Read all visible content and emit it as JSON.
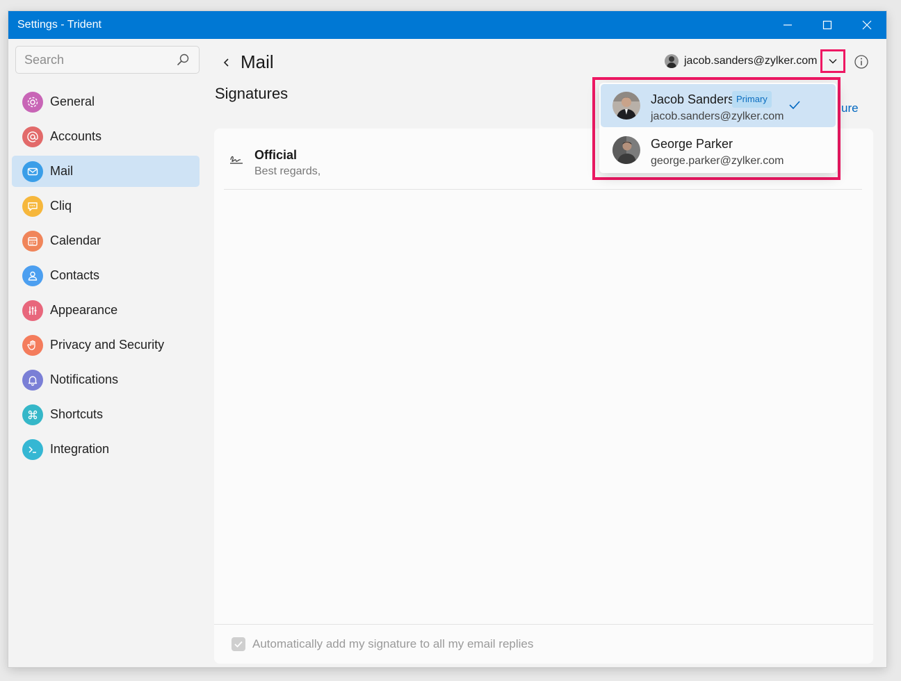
{
  "window": {
    "title": "Settings - Trident"
  },
  "sidebar": {
    "search_placeholder": "Search",
    "items": [
      {
        "label": "General",
        "icon": "gear-icon",
        "color": "#c865b6"
      },
      {
        "label": "Accounts",
        "icon": "at-icon",
        "color": "#e26a6a"
      },
      {
        "label": "Mail",
        "icon": "mail-icon",
        "color": "#3a9ee8",
        "active": true
      },
      {
        "label": "Cliq",
        "icon": "chat-icon",
        "color": "#f6b73c"
      },
      {
        "label": "Calendar",
        "icon": "calendar-icon",
        "color": "#f0855a"
      },
      {
        "label": "Contacts",
        "icon": "person-icon",
        "color": "#4c9ff0"
      },
      {
        "label": "Appearance",
        "icon": "sliders-icon",
        "color": "#e8677c"
      },
      {
        "label": "Privacy and Security",
        "icon": "hand-icon",
        "color": "#f47c5c"
      },
      {
        "label": "Notifications",
        "icon": "bell-icon",
        "color": "#7a7fd6"
      },
      {
        "label": "Shortcuts",
        "icon": "command-icon",
        "color": "#35b7c8"
      },
      {
        "label": "Integration",
        "icon": "terminal-icon",
        "color": "#35b7d3"
      }
    ]
  },
  "main": {
    "title": "Mail",
    "section": "Signatures",
    "account_email": "jacob.sanders@zylker.com",
    "new_signature_link": "ure",
    "signatures": [
      {
        "name": "Official",
        "preview": "Best regards,"
      }
    ],
    "auto_add_label": "Automatically add my signature to all my email replies",
    "auto_add_checked": true
  },
  "account_menu": {
    "items": [
      {
        "name": "Jacob Sanders",
        "email": "jacob.sanders@zylker.com",
        "badge": "Primary",
        "selected": true
      },
      {
        "name": "George Parker",
        "email": "george.parker@zylker.com",
        "selected": false
      }
    ]
  },
  "colors": {
    "accent": "#0078d4",
    "highlight": "#ee1863",
    "selected": "#cfe3f5"
  }
}
